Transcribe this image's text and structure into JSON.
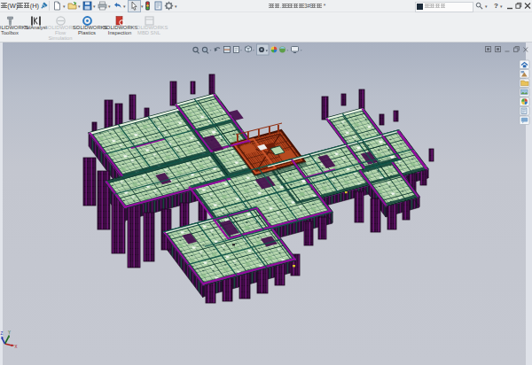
{
  "app": "SOLIDWORKS",
  "window": {
    "title": "友佳.欧尚名城3#总装 *",
    "buttons": {
      "minimize": "–",
      "restore": "❐",
      "close": "✕"
    },
    "help_label": "?"
  },
  "menubar": {
    "items": [
      {
        "label": "口(W)"
      },
      {
        "label": "帮助(H)"
      }
    ],
    "pin_icon": "pushpin-icon"
  },
  "quick_access_toolbar": [
    {
      "name": "new"
    },
    {
      "name": "open"
    },
    {
      "name": "save"
    },
    {
      "name": "print"
    },
    {
      "name": "undo"
    },
    {
      "name": "select",
      "pressed": true
    },
    {
      "name": "rebuild"
    },
    {
      "name": "file-properties"
    },
    {
      "name": "options"
    }
  ],
  "search": {
    "placeholder": "搜索命令"
  },
  "command_manager": {
    "addins": [
      {
        "label": "SOLIDWORKS\nToolbox",
        "enabled": true
      },
      {
        "label": "TolAnalyst",
        "enabled": true
      },
      {
        "label": "SOLIDWORKS\nFlow\nSimulation",
        "enabled": false
      },
      {
        "label": "SOLIDWORKS\nPlastics",
        "enabled": true
      },
      {
        "label": "SOLIDWORKS\nInspection",
        "enabled": true
      },
      {
        "label": "SOLIDWORKS\nMBD SNL",
        "enabled": false
      }
    ]
  },
  "headsup_toolbar": [
    "zoom-to-fit",
    "zoom-to-area",
    "previous-view",
    "section-view",
    "annotation-views",
    "view-orientation",
    "hide-show-items",
    "edit-appearance",
    "apply-scene",
    "view-settings"
  ],
  "document_window_buttons": [
    "restore-a",
    "restore-b",
    "minimize",
    "restore",
    "close"
  ],
  "task_pane_tabs": [
    "solidworks-resources",
    "design-library",
    "file-explorer",
    "view-palette",
    "appearances-scenes",
    "custom-properties",
    "solidworks-forum"
  ],
  "triad": {
    "x": "X",
    "y": "Y",
    "z": "Z"
  },
  "model": {
    "description": "aluminium formwork building floor assembly",
    "colors": {
      "panel_green": "#cde9c8",
      "grid_dark": "#0d4034",
      "teal_edge": "#156a5c",
      "magenta": "#b400b4",
      "purple_dark": "#470b50",
      "red_block": "#a03212",
      "red_light": "#cd6a3f"
    }
  }
}
